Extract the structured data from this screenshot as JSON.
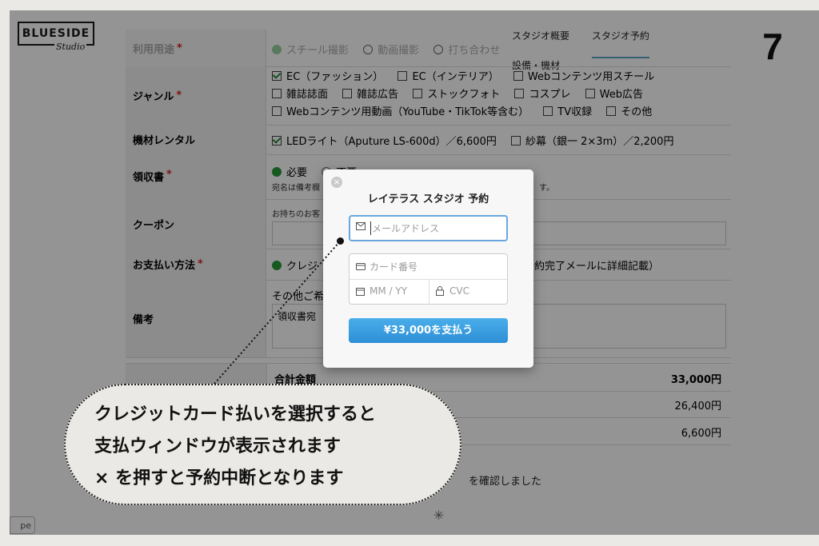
{
  "step_number": "7",
  "logo": {
    "main": "BLUESIDE",
    "sub": "Studio"
  },
  "nav": {
    "items": [
      "スタジオ概要",
      "スタジオ予約",
      "設備・機材"
    ]
  },
  "form": {
    "usage": {
      "label": "利用用途",
      "options": [
        "スチール撮影",
        "動画撮影",
        "打ち合わせ"
      ],
      "selected": 0
    },
    "genre": {
      "label": "ジャンル",
      "lines": [
        [
          {
            "text": "EC（ファッション）",
            "checked": true
          },
          {
            "text": "EC（インテリア）",
            "checked": false
          },
          {
            "text": "Webコンテンツ用スチール",
            "checked": false
          }
        ],
        [
          {
            "text": "雑誌誌面",
            "checked": false
          },
          {
            "text": "雑誌広告",
            "checked": false
          },
          {
            "text": "ストックフォト",
            "checked": false
          },
          {
            "text": "コスプレ",
            "checked": false
          },
          {
            "text": "Web広告",
            "checked": false
          }
        ],
        [
          {
            "text": "Webコンテンツ用動画（YouTube・TikTok等含む）",
            "checked": false
          },
          {
            "text": "TV収録",
            "checked": false
          },
          {
            "text": "その他",
            "checked": false
          }
        ]
      ]
    },
    "equipment": {
      "label": "機材レンタル",
      "items": [
        {
          "text": "LEDライト（Aputure LS-600d）／6,600円",
          "checked": true
        },
        {
          "text": "紗幕（銀一 2×3m）／2,200円",
          "checked": false
        }
      ]
    },
    "receipt": {
      "label": "領収書",
      "options": [
        "必要",
        "不要"
      ],
      "note_start": "宛名は備考欄",
      "note_end": "す。"
    },
    "coupon": {
      "label": "クーポン",
      "hint": "お持ちのお客"
    },
    "payment": {
      "label": "お支払い方法",
      "value_start": "クレジ",
      "value_end": "予約完了メールに詳細記載）"
    },
    "remarks": {
      "label": "備考",
      "prompt": "その他ご希",
      "text": "領収書宛"
    }
  },
  "summary": {
    "total_label": "合計金額",
    "total": "33,000円",
    "sub1": "26,400円",
    "sub2": "6,600円"
  },
  "confirm_text": "を確認しました",
  "modal": {
    "title": "レイテラス スタジオ 予約",
    "email_placeholder": "メールアドレス",
    "card_placeholder": "カード番号",
    "expiry_placeholder": "MM / YY",
    "cvc_placeholder": "CVC",
    "pay_label": "¥33,000を支払う",
    "close_glyph": "×"
  },
  "stripe_tag": "pe",
  "callout": {
    "line1": "クレジットカード払いを選択すると",
    "line2": "支払ウィンドウが表示されます",
    "line3": "× を押すと予約中断となります"
  }
}
